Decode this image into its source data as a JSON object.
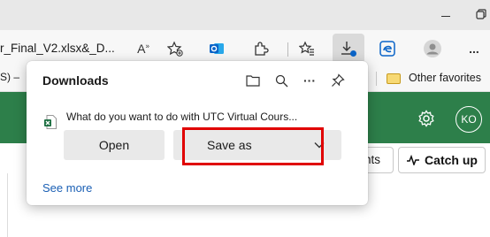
{
  "window": {
    "minimize_glyph": "–",
    "restore_glyph": "⧉"
  },
  "toolbar": {
    "tab_title": "r_Final_V2.xlsx&_D...",
    "read_aloud_glyph": "A",
    "more_glyph": "..."
  },
  "favorites_bar": {
    "left_fragment": "S) –",
    "other_favorites": "Other favorites"
  },
  "teams_header": {
    "avatar_initials": "KO"
  },
  "page": {
    "partial_button": "nts",
    "catch_up": "Catch up"
  },
  "downloads": {
    "title": "Downloads",
    "message": "What do you want to do with UTC Virtual Cours...",
    "open_label": "Open",
    "save_as_label": "Save as",
    "see_more": "See more",
    "more_glyph": "···"
  },
  "colors": {
    "teams_green": "#2d7f4a",
    "highlight_red": "#e00000",
    "link_blue": "#1a5fb4"
  },
  "icons": [
    "minimize-icon",
    "restore-icon",
    "read-aloud-icon",
    "add-tab-icon",
    "outlook-icon",
    "extensions-icon",
    "favorites-icon",
    "downloads-icon",
    "edge-icon",
    "profile-icon",
    "more-icon",
    "folder-icon",
    "search-icon",
    "pin-icon",
    "excel-file-icon",
    "chevron-down-icon",
    "settings-icon",
    "catch-up-icon"
  ]
}
